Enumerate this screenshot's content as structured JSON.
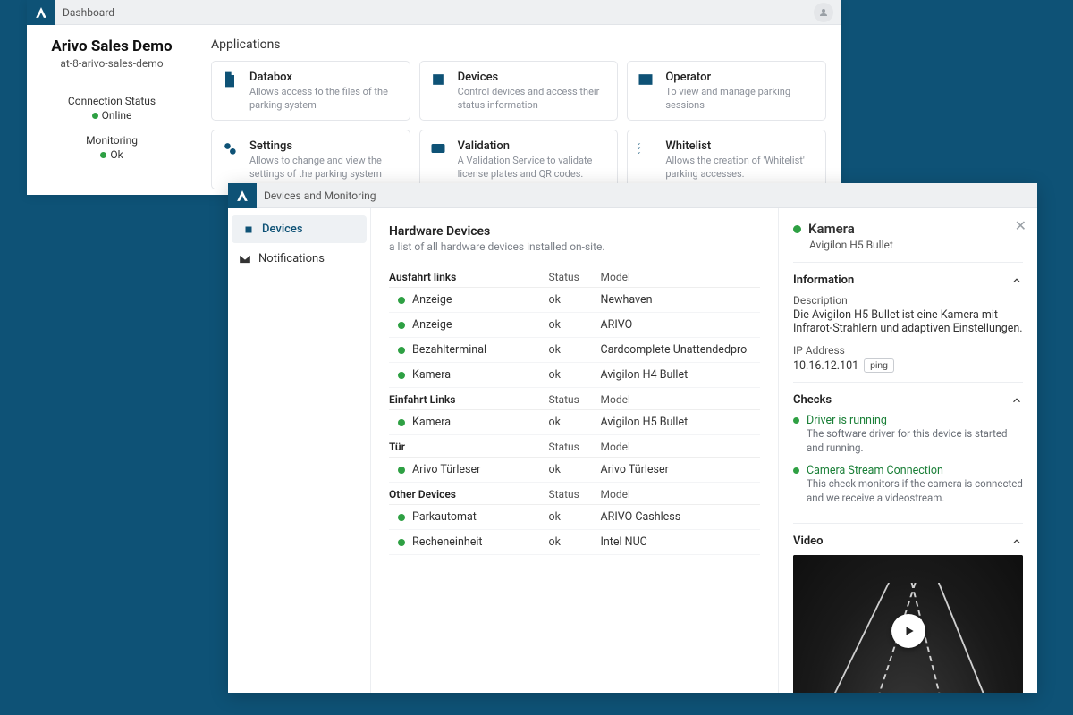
{
  "dashboard": {
    "window_title": "Dashboard",
    "org_name": "Arivo Sales Demo",
    "org_slug": "at-8-arivo-sales-demo",
    "conn_label": "Connection Status",
    "conn_value": "Online",
    "mon_label": "Monitoring",
    "mon_value": "Ok",
    "apps_heading": "Applications",
    "apps": [
      {
        "name": "Databox",
        "desc": "Allows access to the files of the parking system"
      },
      {
        "name": "Devices",
        "desc": "Control devices and access their status information"
      },
      {
        "name": "Operator",
        "desc": "To view and manage parking sessions"
      },
      {
        "name": "Settings",
        "desc": "Allows to change and view the settings of the parking system"
      },
      {
        "name": "Validation",
        "desc": "A Validation Service to validate license plates and QR codes."
      },
      {
        "name": "Whitelist",
        "desc": "Allows the creation of 'Whitelist' parking accesses."
      }
    ]
  },
  "devices": {
    "window_title": "Devices and Monitoring",
    "nav": {
      "devices": "Devices",
      "notifications": "Notifications"
    },
    "heading": "Hardware Devices",
    "subheading": "a list of all hardware devices installed on-site.",
    "col_status": "Status",
    "col_model": "Model",
    "groups": [
      {
        "name": "Ausfahrt links",
        "rows": [
          {
            "name": "Anzeige",
            "status": "ok",
            "model": "Newhaven"
          },
          {
            "name": "Anzeige",
            "status": "ok",
            "model": "ARIVO"
          },
          {
            "name": "Bezahlterminal",
            "status": "ok",
            "model": "Cardcomplete Unattendedpro"
          },
          {
            "name": "Kamera",
            "status": "ok",
            "model": "Avigilon H4 Bullet"
          }
        ]
      },
      {
        "name": "Einfahrt Links",
        "rows": [
          {
            "name": "Kamera",
            "status": "ok",
            "model": "Avigilon H5 Bullet"
          }
        ]
      },
      {
        "name": "Tür",
        "rows": [
          {
            "name": "Arivo Türleser",
            "status": "ok",
            "model": "Arivo Türleser"
          }
        ]
      },
      {
        "name": "Other Devices",
        "rows": [
          {
            "name": "Parkautomat",
            "status": "ok",
            "model": "ARIVO Cashless"
          },
          {
            "name": "Recheneinheit",
            "status": "ok",
            "model": "Intel NUC"
          }
        ]
      }
    ]
  },
  "detail": {
    "title": "Kamera",
    "subtitle": "Avigilon H5 Bullet",
    "info_heading": "Information",
    "desc_label": "Description",
    "desc_value": "Die Avigilon H5 Bullet ist eine Kamera mit Infrarot-Strahlern und adaptiven Einstellungen.",
    "ip_label": "IP Address",
    "ip_value": "10.16.12.101",
    "ping_label": "ping",
    "checks_heading": "Checks",
    "checks": [
      {
        "title": "Driver is running",
        "desc": "The software driver for this device is started and running."
      },
      {
        "title": "Camera Stream Connection",
        "desc": "This check monitors if the camera is connected and we receive a videostream."
      }
    ],
    "video_heading": "Video"
  }
}
